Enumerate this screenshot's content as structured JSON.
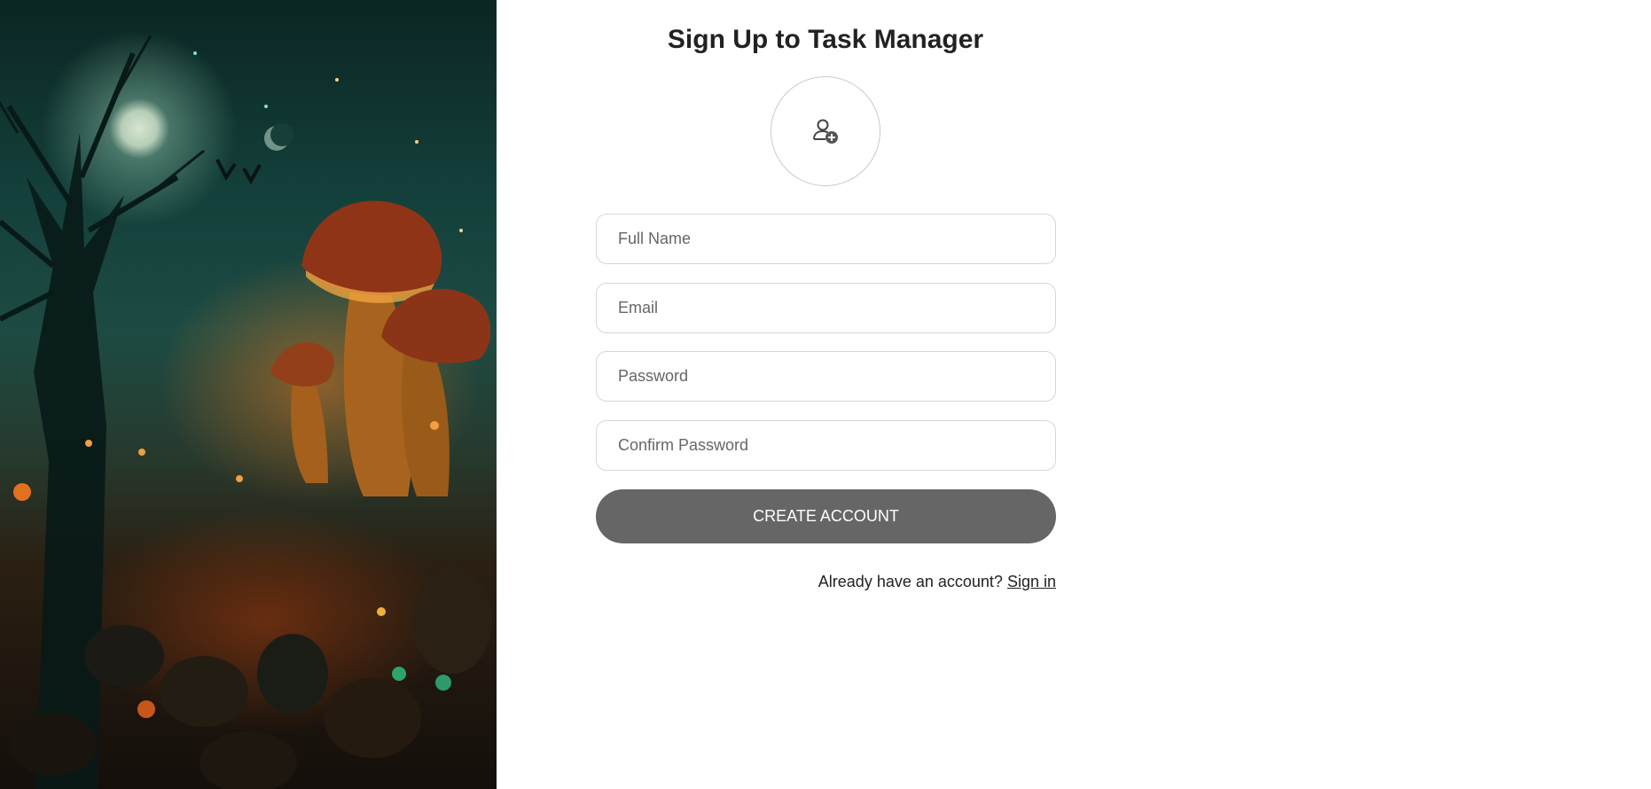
{
  "hero": {
    "description_icon": "fantasy-illustration"
  },
  "form": {
    "title": "Sign Up to Task Manager",
    "avatar_icon": "add-user-icon",
    "fields": {
      "full_name": {
        "placeholder": "Full Name",
        "value": ""
      },
      "email": {
        "placeholder": "Email",
        "value": ""
      },
      "password": {
        "placeholder": "Password",
        "value": ""
      },
      "confirm_password": {
        "placeholder": "Confirm Password",
        "value": ""
      }
    },
    "submit_label": "CREATE ACCOUNT",
    "footer": {
      "prompt": "Already have an account?",
      "link_label": "Sign in"
    }
  },
  "colors": {
    "button_bg": "#666666",
    "title_text": "#222222",
    "field_border": "#d6d6d6"
  }
}
